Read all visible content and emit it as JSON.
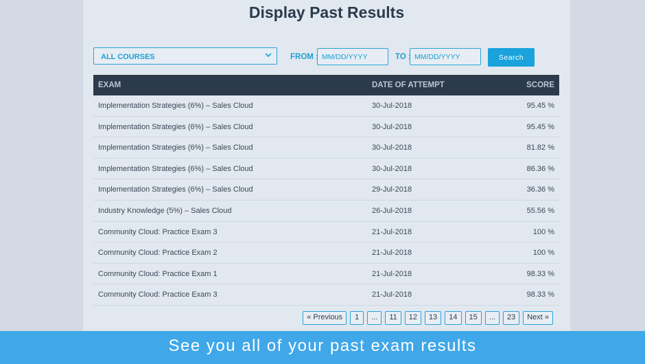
{
  "page": {
    "title": "Display Past Results"
  },
  "filters": {
    "course_value": "ALL COURSES",
    "from_label": "FROM :",
    "from_placeholder": "MM/DD/YYYY",
    "to_label": "TO :",
    "to_placeholder": "MM/DD/YYYY",
    "search_label": "Search"
  },
  "table": {
    "headers": {
      "exam": "EXAM",
      "date": "DATE OF ATTEMPT",
      "score": "SCORE"
    },
    "rows": [
      {
        "exam": "Implementation Strategies (6%) – Sales Cloud",
        "date": "30-Jul-2018",
        "score": "95.45 %"
      },
      {
        "exam": "Implementation Strategies (6%) – Sales Cloud",
        "date": "30-Jul-2018",
        "score": "95.45 %"
      },
      {
        "exam": "Implementation Strategies (6%) – Sales Cloud",
        "date": "30-Jul-2018",
        "score": "81.82 %"
      },
      {
        "exam": "Implementation Strategies (6%) – Sales Cloud",
        "date": "30-Jul-2018",
        "score": "86.36 %"
      },
      {
        "exam": "Implementation Strategies (6%) – Sales Cloud",
        "date": "29-Jul-2018",
        "score": "36.36 %"
      },
      {
        "exam": "Industry Knowledge (5%) – Sales Cloud",
        "date": "26-Jul-2018",
        "score": "55.56 %"
      },
      {
        "exam": "Community Cloud: Practice Exam 3",
        "date": "21-Jul-2018",
        "score": "100 %"
      },
      {
        "exam": "Community Cloud: Practice Exam 2",
        "date": "21-Jul-2018",
        "score": "100 %"
      },
      {
        "exam": "Community Cloud: Practice Exam 1",
        "date": "21-Jul-2018",
        "score": "98.33 %"
      },
      {
        "exam": "Community Cloud: Practice Exam 3",
        "date": "21-Jul-2018",
        "score": "98.33 %"
      }
    ]
  },
  "pagination": [
    "« Previous",
    "1",
    "...",
    "11",
    "12",
    "13",
    "14",
    "15",
    "...",
    "23",
    "Next »"
  ],
  "banner": {
    "text": "See you all of your past exam results"
  },
  "colors": {
    "accent": "#1aa2dc",
    "header_bg": "#2c3b4c",
    "banner_bg": "#40a7e8",
    "panel_bg": "#e2e8ef"
  }
}
